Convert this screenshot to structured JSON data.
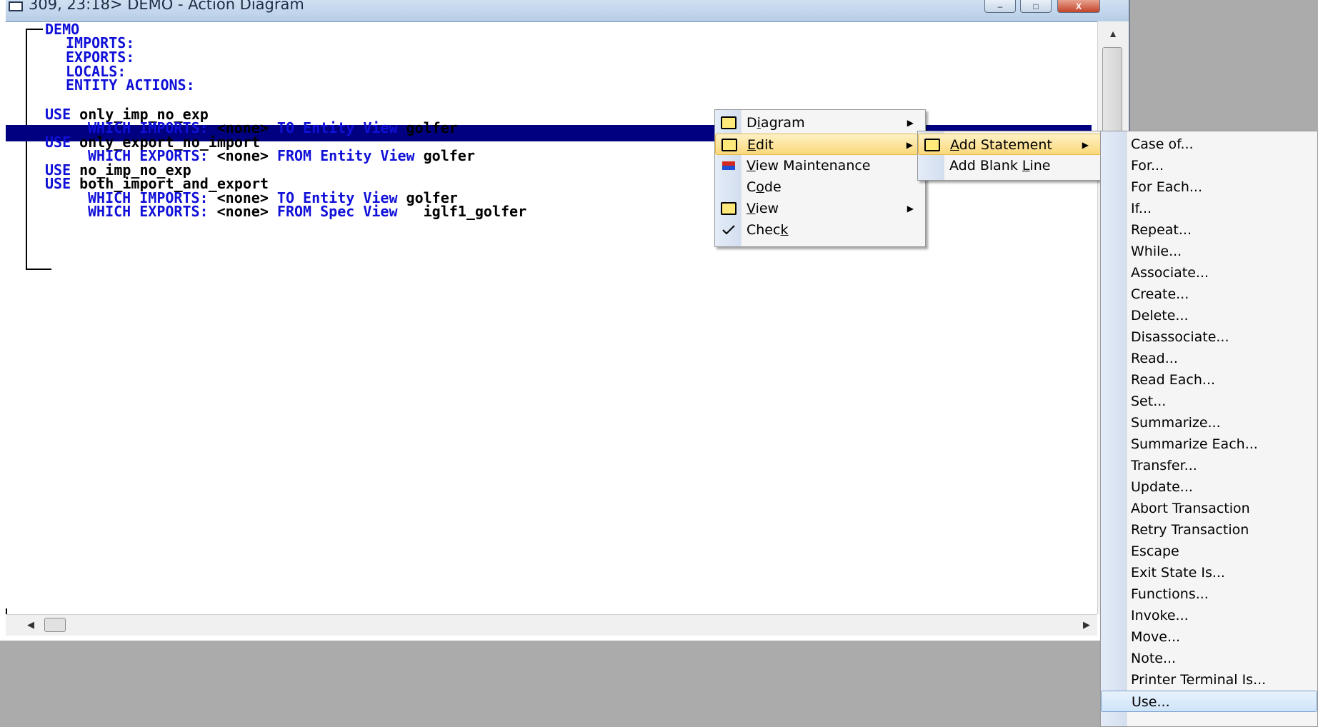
{
  "window": {
    "title": "309, 23:18> DEMO - Action Diagram",
    "buttons": {
      "minimize": "–",
      "maximize": "□",
      "close": "X"
    }
  },
  "editor": {
    "lines": [
      {
        "kw": "DEMO",
        "rest": ""
      },
      {
        "kw": "IMPORTS:",
        "rest": ""
      },
      {
        "kw": "EXPORTS:",
        "rest": ""
      },
      {
        "kw": "LOCALS:",
        "rest": ""
      },
      {
        "kw": "ENTITY ACTIONS:",
        "rest": ""
      },
      {
        "kw": "",
        "rest": ""
      },
      {
        "kw": "USE",
        "rest": " only_imp_no_exp"
      },
      {
        "kw": "WHICH IMPORTS:",
        "rest": " <none>",
        "kw2": " TO Entity View",
        "rest2": " golfer"
      },
      {
        "kw": "USE",
        "rest": " only_export_no_import"
      },
      {
        "kw": "WHICH EXPORTS:",
        "rest": " <none>",
        "kw2": " FROM Entity View",
        "rest2": " golfer"
      },
      {
        "kw": "USE",
        "rest": " no_imp_no_exp"
      },
      {
        "kw": "USE",
        "rest": " both_import_and_export"
      },
      {
        "kw": "WHICH IMPORTS:",
        "rest": " <none>",
        "kw2": " TO Entity View",
        "rest2": " golfer"
      },
      {
        "kw": "WHICH EXPORTS:",
        "rest": " <none>",
        "kw2": " FROM Spec View",
        "rest2": "   iglf1_golfer"
      }
    ],
    "colors": {
      "keyword": "#1010d8",
      "selection": "#000080"
    }
  },
  "context_menu": {
    "items": [
      {
        "label_pre": "D",
        "label_u": "i",
        "label_post": "agram",
        "icon": "folder-icon",
        "submenu": true
      },
      {
        "label_pre": "",
        "label_u": "E",
        "label_post": "dit",
        "icon": "folder-icon",
        "submenu": true,
        "highlighted": true
      },
      {
        "label_pre": "",
        "label_u": "V",
        "label_post": "iew Maintenance",
        "icon": "view-maintenance-icon",
        "submenu": false
      },
      {
        "label_pre": "C",
        "label_u": "o",
        "label_post": "de",
        "icon": "",
        "submenu": false
      },
      {
        "label_pre": "",
        "label_u": "V",
        "label_post": "iew",
        "icon": "folder-icon",
        "submenu": true
      },
      {
        "label_pre": "Chec",
        "label_u": "k",
        "label_post": "",
        "icon": "checkmark-icon",
        "submenu": false
      }
    ]
  },
  "edit_submenu": {
    "items": [
      {
        "label_pre": "",
        "label_u": "A",
        "label_post": "dd Statement",
        "icon": "folder-icon",
        "submenu": true,
        "highlighted": true
      },
      {
        "label_pre": "Add Blank ",
        "label_u": "L",
        "label_post": "ine",
        "icon": "",
        "submenu": false
      }
    ]
  },
  "statement_submenu": {
    "items": [
      "Case of...",
      "For...",
      "For Each...",
      "If...",
      "Repeat...",
      "While...",
      "Associate...",
      "Create...",
      "Delete...",
      "Disassociate...",
      "Read...",
      "Read Each...",
      "Set...",
      "Summarize...",
      "Summarize Each...",
      "Transfer...",
      "Update...",
      "Abort Transaction",
      "Retry Transaction",
      "Escape",
      "Exit State Is...",
      "Functions...",
      "Invoke...",
      "Move...",
      "Note...",
      "Printer Terminal Is...",
      "Use..."
    ],
    "highlighted_item": "Use..."
  }
}
